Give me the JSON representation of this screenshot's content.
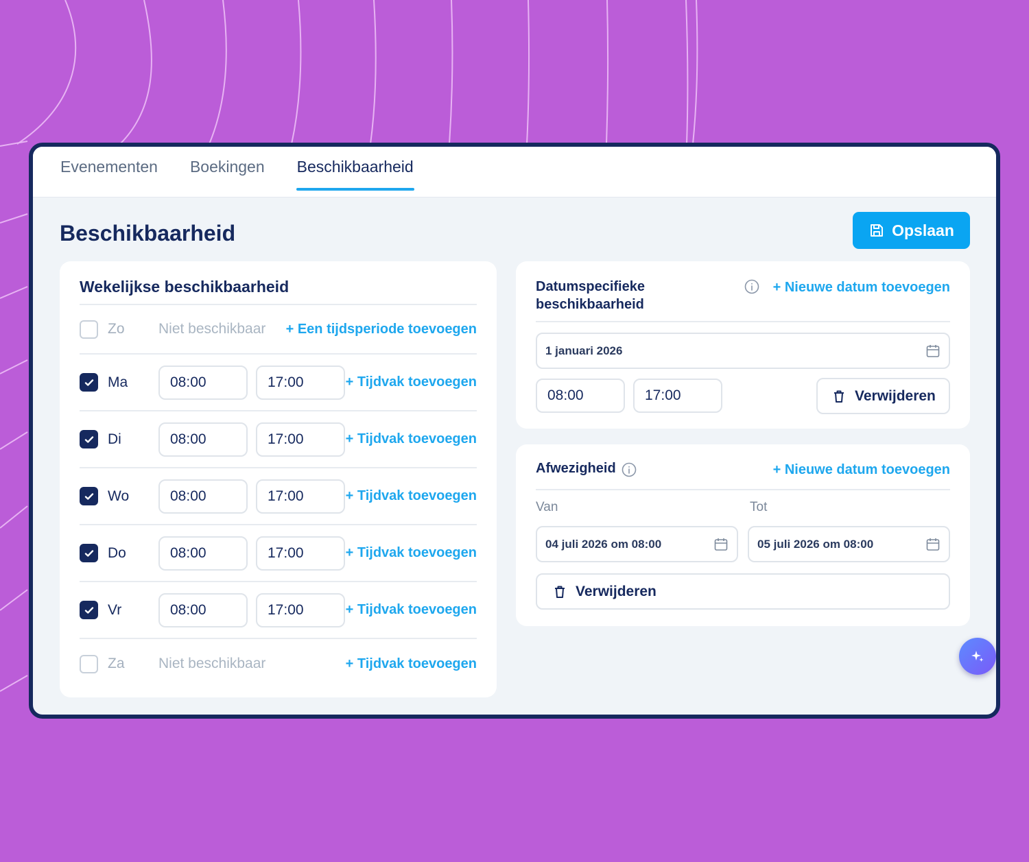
{
  "tabs": [
    {
      "label": "Evenementen",
      "active": false
    },
    {
      "label": "Boekingen",
      "active": false
    },
    {
      "label": "Beschikbaarheid",
      "active": true
    }
  ],
  "page": {
    "title": "Beschikbaarheid",
    "save_label": "Opslaan"
  },
  "weekly": {
    "title": "Wekelijkse beschikbaarheid",
    "not_available_label": "Niet beschikbaar",
    "days": [
      {
        "label": "Zo",
        "checked": false,
        "link": "+ Een tijdsperiode toevoegen"
      },
      {
        "label": "Ma",
        "checked": true,
        "start": "08:00",
        "end": "17:00",
        "link": "+ Tijdvak toevoegen"
      },
      {
        "label": "Di",
        "checked": true,
        "start": "08:00",
        "end": "17:00",
        "link": "+ Tijdvak toevoegen"
      },
      {
        "label": "Wo",
        "checked": true,
        "start": "08:00",
        "end": "17:00",
        "link": "+ Tijdvak toevoegen"
      },
      {
        "label": "Do",
        "checked": true,
        "start": "08:00",
        "end": "17:00",
        "link": "+ Tijdvak toevoegen"
      },
      {
        "label": "Vr",
        "checked": true,
        "start": "08:00",
        "end": "17:00",
        "link": "+ Tijdvak toevoegen"
      },
      {
        "label": "Za",
        "checked": false,
        "link": "+ Tijdvak toevoegen"
      }
    ]
  },
  "date_specific": {
    "title": "Datumspecifieke beschikbaarheid",
    "add_link": "+ Nieuwe datum toevoegen",
    "date": "1 januari 2026",
    "start": "08:00",
    "end": "17:00",
    "delete_label": "Verwijderen"
  },
  "absence": {
    "title": "Afwezigheid",
    "add_link": "+ Nieuwe datum toevoegen",
    "from_label": "Van",
    "to_label": "Tot",
    "from_value": "04 juli 2026 om 08:00",
    "to_value": "05 juli 2026 om 08:00",
    "delete_label": "Verwijderen"
  },
  "colors": {
    "accent": "#1ea7ee",
    "primary": "#16295e",
    "background": "#bb5dd8"
  },
  "icons": {
    "save": "save-icon",
    "calendar": "calendar-icon",
    "trash": "trash-icon",
    "info": "info-icon",
    "assistant": "sparkle-icon",
    "check": "check-icon"
  }
}
